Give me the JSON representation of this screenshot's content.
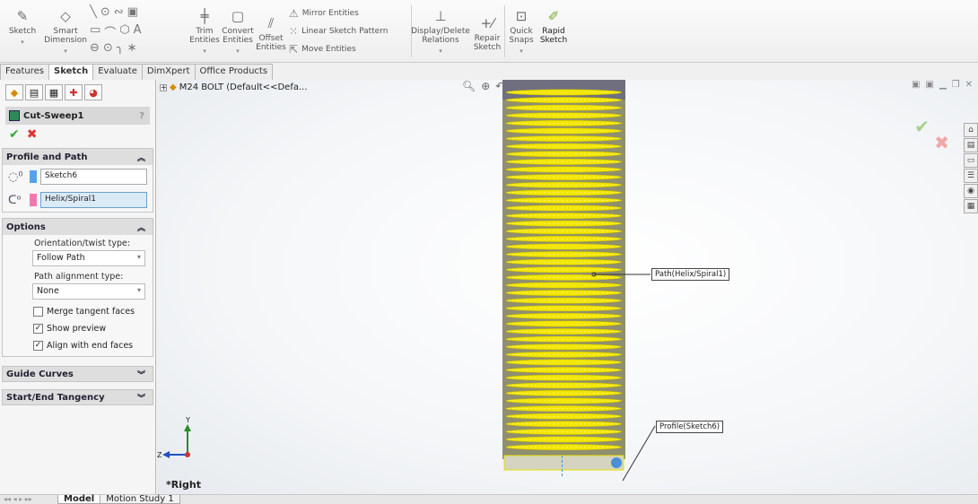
{
  "ribbon": {
    "sketch": "Sketch",
    "smart_dimension": "Smart Dimension",
    "trim_entities": "Trim Entities",
    "convert_entities": "Convert Entities",
    "offset_entities": "Offset Entities",
    "mirror_entities": "Mirror Entities",
    "linear_sketch_pattern": "Linear Sketch Pattern",
    "move_entities": "Move Entities",
    "display_delete_relations": "Display/Delete Relations",
    "repair_sketch": "Repair Sketch",
    "quick_snaps": "Quick Snaps",
    "rapid_sketch": "Rapid Sketch"
  },
  "tabs": [
    "Features",
    "Sketch",
    "Evaluate",
    "DimXpert",
    "Office Products"
  ],
  "active_tab": "Sketch",
  "property_manager": {
    "title": "Cut-Sweep1",
    "help": "?",
    "profile_and_path": {
      "header": "Profile and Path",
      "profile_value": "Sketch6",
      "path_value": "Helix/Spiral1"
    },
    "options": {
      "header": "Options",
      "orientation_label": "Orientation/twist type:",
      "orientation_value": "Follow Path",
      "path_alignment_label": "Path alignment type:",
      "path_alignment_value": "None",
      "merge_tangent_faces": "Merge tangent faces",
      "show_preview": "Show preview",
      "align_with_end_faces": "Align with end faces"
    },
    "guide_curves": "Guide Curves",
    "start_end_tangency": "Start/End Tangency"
  },
  "graphics": {
    "tree_item": "M24 BOLT  (Default<<Defa...",
    "callout_path": "Path(Helix/Spiral1)",
    "callout_profile": "Profile(Sketch6)",
    "view_label": "*Right",
    "axis_y": "Y",
    "axis_z": "Z"
  },
  "bottom_tabs": [
    "Model",
    "Motion Study 1"
  ],
  "colors": {
    "thread": "#f2e600",
    "bolt_body": "#8f8f70",
    "accent_blue": "#4b8fd6"
  }
}
